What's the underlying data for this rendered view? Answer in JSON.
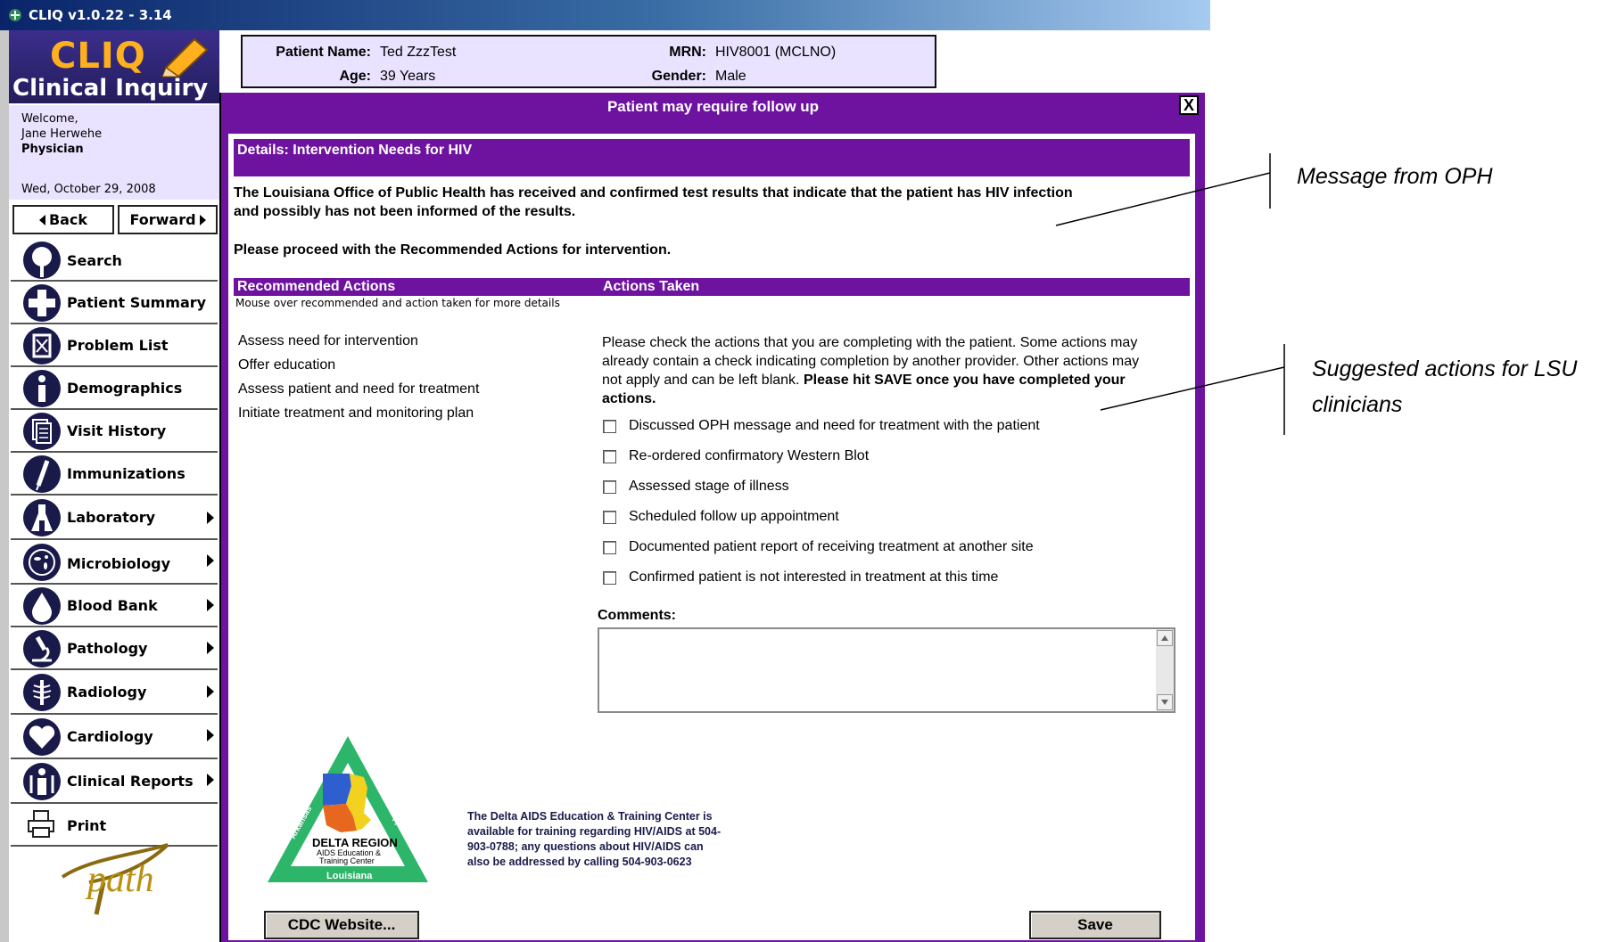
{
  "window": {
    "title": "CLIQ v1.0.22 - 3.14"
  },
  "logo": {
    "name": "CLIQ",
    "subtitle": "Clinical Inquiry"
  },
  "user": {
    "welcome": "Welcome,",
    "name": "Jane Herwehe",
    "role": "Physician",
    "date": "Wed, October 29, 2008"
  },
  "nav": {
    "back": "Back",
    "forward": "Forward"
  },
  "sidebar": {
    "items": [
      {
        "label": "Search",
        "icon": "search-icon",
        "submenu": false
      },
      {
        "label": "Patient Summary",
        "icon": "plus-icon",
        "submenu": false
      },
      {
        "label": "Problem List",
        "icon": "problem-list-icon",
        "submenu": false
      },
      {
        "label": "Demographics",
        "icon": "info-icon",
        "submenu": false
      },
      {
        "label": "Visit History",
        "icon": "documents-icon",
        "submenu": false
      },
      {
        "label": "Immunizations",
        "icon": "syringe-icon",
        "submenu": false
      },
      {
        "label": "Laboratory",
        "icon": "flask-icon",
        "submenu": true
      },
      {
        "label": "Microbiology",
        "icon": "microbe-icon",
        "submenu": true
      },
      {
        "label": "Blood Bank",
        "icon": "blood-drop-icon",
        "submenu": true
      },
      {
        "label": "Pathology",
        "icon": "microscope-icon",
        "submenu": true
      },
      {
        "label": "Radiology",
        "icon": "xray-icon",
        "submenu": true
      },
      {
        "label": "Cardiology",
        "icon": "heart-icon",
        "submenu": true
      },
      {
        "label": "Clinical Reports",
        "icon": "reports-icon",
        "submenu": true
      },
      {
        "label": "Print",
        "icon": "printer-icon",
        "submenu": false
      }
    ],
    "footer_logo": "path"
  },
  "patient": {
    "name_label": "Patient Name:",
    "name": "Ted ZzzTest",
    "mrn_label": "MRN:",
    "mrn": "HIV8001 (MCLNO)",
    "age_label": "Age:",
    "age": "39 Years",
    "gender_label": "Gender:",
    "gender": "Male"
  },
  "dialog": {
    "title": "Patient may require follow up",
    "close": "X",
    "details_header": "Details: Intervention Needs for HIV",
    "message_line1": "The Louisiana Office of Public Health has received and confirmed test results that indicate that the patient has HIV infection",
    "message_line2": "and possibly has not been informed of the results.",
    "proceed": "Please proceed with the Recommended Actions for intervention.",
    "recommended_header": "Recommended Actions",
    "actions_header": "Actions Taken",
    "mouseover_hint": "Mouse over recommended and action taken for more details",
    "recommended": [
      "Assess need for intervention",
      "Offer education",
      "Assess patient and need for treatment",
      "Initiate treatment and monitoring plan"
    ],
    "instructions_line1": "Please check the actions that you are completing with the patient. Some actions may",
    "instructions_line2": "already contain a check indicating completion by another provider. Other actions may",
    "instructions_line3_plain": "not apply and can be left blank.",
    "instructions_line3_bold": "Please hit SAVE once you have completed your",
    "instructions_line4_bold": "actions.",
    "actions": [
      {
        "label": "Discussed OPH message and need for treatment with the patient",
        "checked": false
      },
      {
        "label": "Re-ordered confirmatory Western Blot",
        "checked": false
      },
      {
        "label": "Assessed stage of illness",
        "checked": false
      },
      {
        "label": "Scheduled follow up appointment",
        "checked": false
      },
      {
        "label": "Documented patient report of receiving treatment at another site",
        "checked": false
      },
      {
        "label": "Confirmed patient is not interested in treatment at this time",
        "checked": false
      }
    ],
    "comments_label": "Comments:",
    "comments_value": "",
    "aetc_logo": {
      "line1": "DELTA REGION",
      "line2": "AIDS Education &",
      "line3": "Training Center",
      "bottom": "Louisiana",
      "left_side": "Arkansas",
      "right_side": "Mississippi"
    },
    "aetc_text": "The Delta AIDS Education & Training Center is available for training regarding HIV/AIDS at 504-903-0788; any questions about HIV/AIDS can also be addressed by calling 504-903-0623",
    "cdc_button": "CDC Website...",
    "save_button": "Save"
  },
  "annotations": {
    "oph": "Message from OPH",
    "lsu_line1": "Suggested actions for LSU",
    "lsu_line2": "clinicians"
  },
  "colors": {
    "purple": "#6e12a0",
    "lavender": "#e9e3ff",
    "navy": "#1a1a4a",
    "logo_orange": "#ffb01e"
  }
}
